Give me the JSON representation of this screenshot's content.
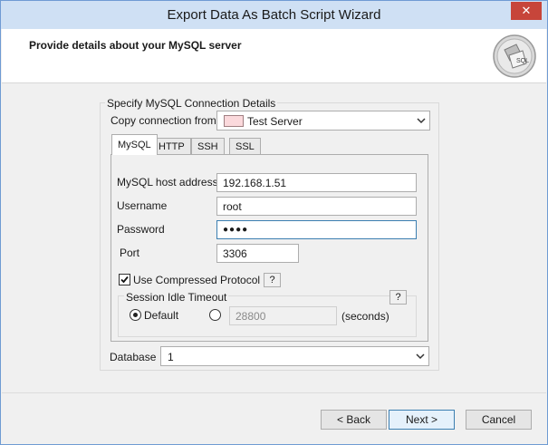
{
  "window": {
    "title": "Export Data As Batch Script Wizard",
    "close_glyph": "✕"
  },
  "header": {
    "heading": "Provide details about your MySQL server",
    "icon": "sql-wizard-icon",
    "icon_text": "SQL"
  },
  "connection": {
    "group_title": "Specify MySQL Connection Details",
    "copy_label": "Copy connection from",
    "copy_value": "Test Server",
    "swatch_color": "#fbd9dc"
  },
  "tabs": [
    {
      "label": "MySQL",
      "active": true
    },
    {
      "label": "HTTP",
      "active": false
    },
    {
      "label": "SSH",
      "active": false
    },
    {
      "label": "SSL",
      "active": false
    }
  ],
  "mysql": {
    "host_label": "MySQL host address",
    "host_value": "192.168.1.51",
    "username_label": "Username",
    "username_value": "root",
    "password_label": "Password",
    "password_value": "●●●●",
    "port_label": "Port",
    "port_value": "3306",
    "compressed_label": "Use Compressed Protocol",
    "compressed_checked": true,
    "help": "?"
  },
  "timeout": {
    "title": "Session Idle Timeout",
    "default_label": "Default",
    "default_selected": true,
    "custom_value": "28800",
    "unit": "(seconds)",
    "help": "?"
  },
  "database": {
    "label": "Database",
    "value": "1"
  },
  "buttons": {
    "back": "< Back",
    "next": "Next >",
    "cancel": "Cancel"
  },
  "colors": {
    "accent": "#3c7fb1",
    "titlebar": "#cfe0f4",
    "close": "#c7453a"
  }
}
